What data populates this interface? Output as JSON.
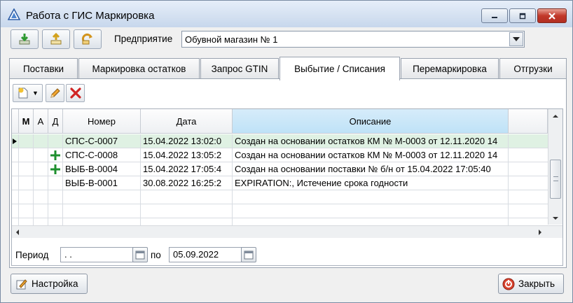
{
  "window": {
    "title": "Работа с ГИС Маркировка"
  },
  "toolbar": {
    "enterprise_label": "Предприятие",
    "enterprise_value": "Обувной магазин № 1"
  },
  "tabs": [
    {
      "label": "Поставки"
    },
    {
      "label": "Маркировка остатков"
    },
    {
      "label": "Запрос GTIN"
    },
    {
      "label": "Выбытие / Списания"
    },
    {
      "label": "Перемаркировка"
    },
    {
      "label": "Отгрузки"
    }
  ],
  "active_tab": "Выбытие / Списания",
  "grid": {
    "columns": [
      "М",
      "А",
      "Д",
      "Номер",
      "Дата",
      "Описание"
    ],
    "rows": [
      {
        "m": "",
        "a": "",
        "d": "",
        "number": "СПС-С-0007",
        "date": "15.04.2022 13:02:0",
        "description": "Создан на основании остатков КМ № М-0003 от 12.11.2020 14"
      },
      {
        "m": "",
        "a": "",
        "d": "plus-icon",
        "number": "СПС-С-0008",
        "date": "15.04.2022 13:05:2",
        "description": "Создан на основании остатков КМ № М-0003 от 12.11.2020 14"
      },
      {
        "m": "",
        "a": "",
        "d": "plus-icon",
        "number": "ВЫБ-В-0004",
        "date": "15.04.2022 17:05:4",
        "description": "Создан на основании поставки № б/н от 15.04.2022 17:05:40"
      },
      {
        "m": "",
        "a": "",
        "d": "",
        "number": "ВЫБ-В-0001",
        "date": "30.08.2022 16:25:2",
        "description": "EXPIRATION:, Истечение срока годности"
      }
    ]
  },
  "period": {
    "label": "Период",
    "from_value": ". .",
    "to_label": "по",
    "to_value": "05.09.2022"
  },
  "footer": {
    "settings_label": "Настройка",
    "close_label": "Закрыть"
  },
  "colors": {
    "current_row": "#dff1e3",
    "selected_header": "#bfe2f7",
    "plus_green": "#1e8f2e",
    "delete_red": "#d02424"
  }
}
